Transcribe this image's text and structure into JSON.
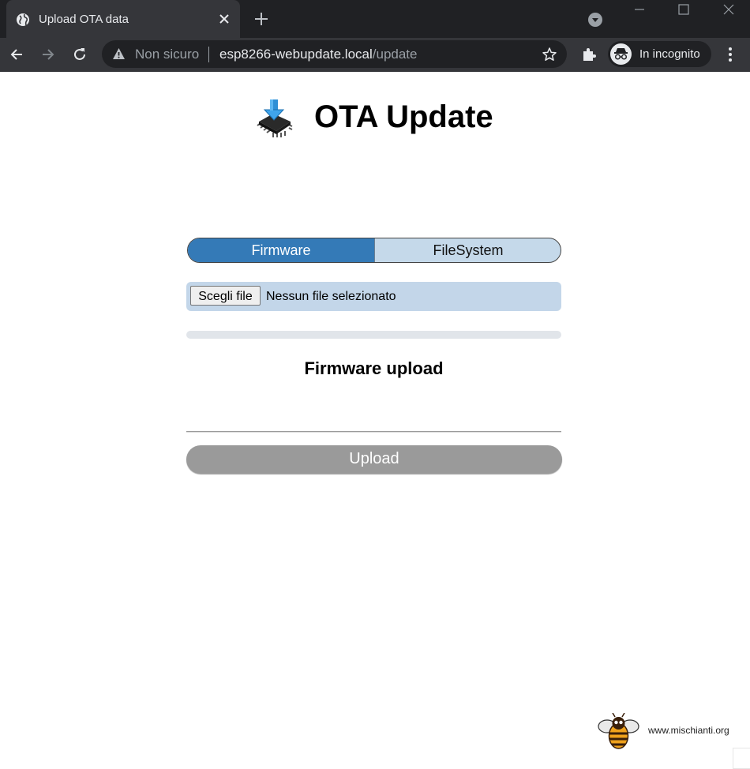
{
  "browser": {
    "tab": {
      "title": "Upload OTA data",
      "favicon": "globe-icon"
    },
    "address_bar": {
      "security_label": "Non sicuro",
      "url_host": "esp8266-webupdate.local",
      "url_path": "/update"
    },
    "profile": {
      "label": "In incognito"
    },
    "colors": {
      "tabstrip": "#202124",
      "toolbar": "#35363a",
      "omnibox": "#202124"
    }
  },
  "page": {
    "title": "OTA Update",
    "logo_icon": "chip-download-icon",
    "mode_selector": {
      "options": [
        "Firmware",
        "FileSystem"
      ],
      "selected": "Firmware"
    },
    "file_input": {
      "button_label": "Scegli file",
      "status": "Nessun file selezionato"
    },
    "progress": {
      "value": 0
    },
    "section_title": "Firmware upload",
    "upload_button": {
      "label": "Upload"
    },
    "footer": {
      "site": "www.mischianti.org",
      "logo_icon": "bee-logo-icon"
    },
    "colors": {
      "accent": "#347ab7",
      "segment_inactive": "#c5d9ea",
      "file_row": "#c3d6e9",
      "upload_disabled": "#9a9a9a"
    }
  }
}
